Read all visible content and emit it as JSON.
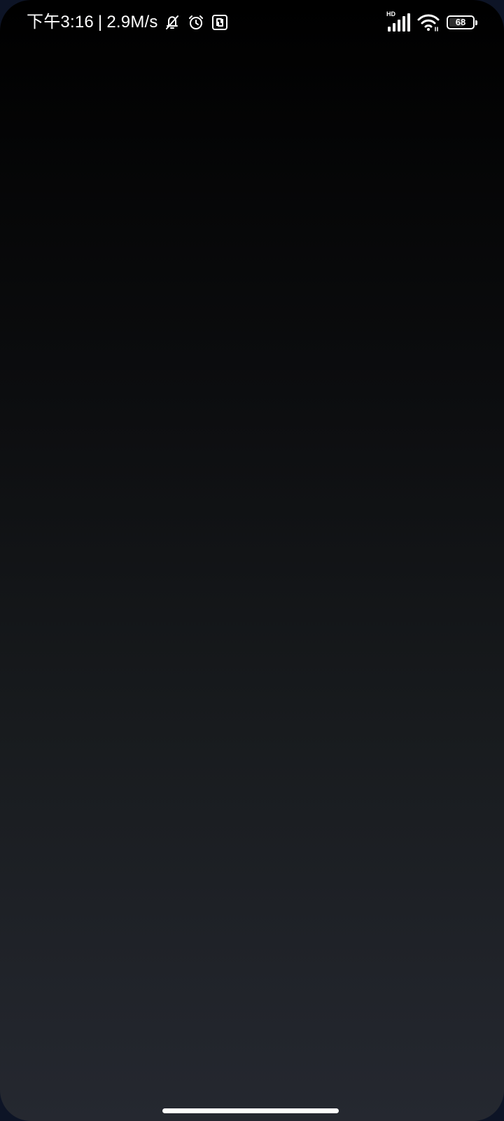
{
  "status_bar": {
    "time": "下午3:16",
    "separator": "|",
    "network_speed": "2.9M/s",
    "icons_left": [
      "bell-muted-icon",
      "alarm-clock-icon",
      "nfc-icon"
    ],
    "network_type": "HD",
    "icons_right": [
      "cellular-signal-icon",
      "wifi-icon",
      "battery-icon"
    ],
    "battery_level": "68",
    "battery_fraction": 0.68
  },
  "screen": {
    "content": "",
    "colors": {
      "top": "#000000",
      "bottom": "#252830",
      "frame": "#0d1426"
    }
  },
  "navigation": {
    "gesture_bar": "home-indicator"
  }
}
